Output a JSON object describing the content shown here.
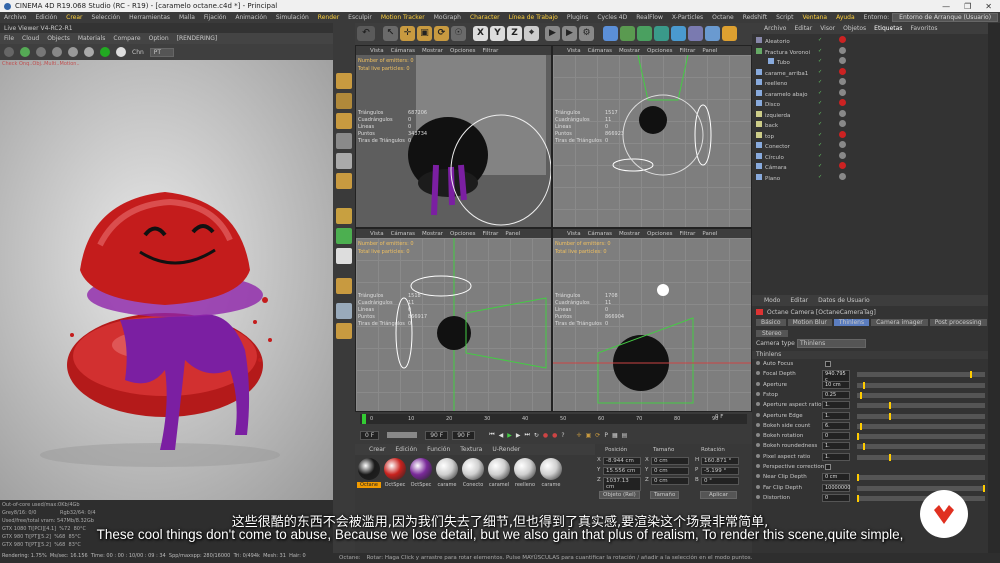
{
  "window": {
    "title": "CINEMA 4D R19.068 Studio (RC - R19) - [caramelo octane.c4d *] - Principal",
    "controls": [
      "—",
      "❐",
      "✕"
    ]
  },
  "menubar": {
    "items": [
      "Archivo",
      "Edición",
      "Crear",
      "Selección",
      "Herramientas",
      "Malla",
      "Fijación",
      "Animación",
      "Simulación",
      "Render",
      "Esculpir",
      "Motion Tracker",
      "MoGraph",
      "Character",
      "Línea de Trabajo",
      "Plugins",
      "Cycles 4D",
      "RealFlow",
      "X-Particles",
      "Octane",
      "Redshift",
      "Script",
      "Ventana",
      "Ayuda"
    ],
    "env_label": "Entorno:",
    "env_value": "Entorno de Arranque (Usuario)"
  },
  "live_viewer": {
    "title": "Live Viewer V4-RC2-R1",
    "menu": [
      "File",
      "Cloud",
      "Objects",
      "Materials",
      "Compare",
      "Option"
    ],
    "rendering_tag": "[RENDERING]",
    "channel_label": "Chn",
    "channel_value": "PT",
    "check_msg": "Check Onq..Obj..Multi..Motion..",
    "stats": [
      {
        "gpu": "GTX 1080 Ti[PCI][4.1]",
        "pct": "%72",
        "temp": "80°C"
      },
      {
        "gpu": "GTX 980 Ti[PT][5.2]",
        "pct": "%68",
        "temp": "85°C"
      },
      {
        "gpu": "GTX 980 Ti[PT][5.2]",
        "pct": "%68",
        "temp": "83°C"
      }
    ],
    "out_of_core": "Out-of-core used/max:0Kb/4Gb",
    "grey": "Grey8/16: 0/0",
    "rgb": "Rgb32/64: 0/4",
    "vram": "Used/free/total vram: 547Mb/8.32Gb",
    "rendering": "Rendering: 1.75%",
    "ms": "Ms/sec: 16.156",
    "time": "Time: 00 : 00 : 10/00 : 09 : 34",
    "spp": "Spp/maxspp: 280/16000",
    "tri": "Tri: 0/494k",
    "mesh": "Mesh: 31",
    "hair": "Hair: 0"
  },
  "viewport_menu": [
    "Vista",
    "Cámaras",
    "Mostrar",
    "Opciones",
    "Filtrar",
    "Panel"
  ],
  "viewports": [
    {
      "emitters": "Number of emitters: 0",
      "particles": "Total live particles: 0",
      "stats_labels": [
        "Triángulos",
        "Cuadrángulos",
        "Líneas",
        "Puntos",
        "Tiras de Triángulos"
      ],
      "stats_values": [
        "687206",
        "0",
        "0",
        "343734",
        "0"
      ]
    },
    {
      "emitters": "",
      "particles": "",
      "stats_labels": [
        "Triángulos",
        "Cuadrángulos",
        "Líneas",
        "Puntos",
        "Tiras de Triángulos"
      ],
      "stats_values": [
        "1517",
        "11",
        "0",
        "866923",
        "0"
      ]
    },
    {
      "emitters": "Number of emitters: 0",
      "particles": "Total live particles: 0",
      "stats_labels": [
        "Triángulos",
        "Cuadrángulos",
        "Líneas",
        "Puntos",
        "Tiras de Triángulos"
      ],
      "stats_values": [
        "1518",
        "11",
        "0",
        "866917",
        "0"
      ]
    },
    {
      "emitters": "Number of emitters: 0",
      "particles": "Total live particles: 0",
      "stats_labels": [
        "Triángulos",
        "Cuadrángulos",
        "Líneas",
        "Puntos",
        "Tiras de Triángulos"
      ],
      "stats_values": [
        "1708",
        "11",
        "0",
        "866904",
        "0"
      ]
    }
  ],
  "toolbar": {
    "axis_x": "X",
    "axis_y": "Y",
    "axis_z": "Z"
  },
  "timeline": {
    "ticks": [
      "0",
      "10",
      "20",
      "30",
      "40",
      "50",
      "60",
      "70",
      "80",
      "90"
    ],
    "end_label": "0 F",
    "start_field": "0 F",
    "current_field": "90 F",
    "end_field": "90 F"
  },
  "materials": {
    "menu": [
      "Crear",
      "Edición",
      "Función",
      "Textura",
      "U-Render"
    ],
    "items": [
      {
        "name": "Octane",
        "color": "#1a1a1a"
      },
      {
        "name": "OctSpec",
        "color": "#c8221e"
      },
      {
        "name": "OctSpec",
        "color": "#7a2a9a"
      },
      {
        "name": "carame",
        "color": "#cfcfcf"
      },
      {
        "name": "Conecto",
        "color": "#cfcfcf"
      },
      {
        "name": "caramel",
        "color": "#cfcfcf"
      },
      {
        "name": "reelleno",
        "color": "#cfcfcf"
      },
      {
        "name": "carame",
        "color": "#cfcfcf"
      }
    ]
  },
  "coords": {
    "headers": [
      "Posición",
      "Tamaño",
      "Rotación"
    ],
    "rows": [
      {
        "axis": "X",
        "pos": "-8.944 cm",
        "size_axis": "X",
        "size": "0 cm",
        "rot_axis": "H",
        "rot": "160.871 °"
      },
      {
        "axis": "Y",
        "pos": "15.556 cm",
        "size_axis": "Y",
        "size": "0 cm",
        "rot_axis": "P",
        "rot": "-5.199 °"
      },
      {
        "axis": "Z",
        "pos": "1037.13 cm",
        "size_axis": "Z",
        "size": "0 cm",
        "rot_axis": "B",
        "rot": "0 °"
      }
    ],
    "mode": "Objeto (Rel)",
    "size_mode": "Tamaño",
    "apply": "Aplicar"
  },
  "object_manager": {
    "menu": [
      "Archivo",
      "Editar",
      "Visor",
      "Objetos",
      "Etiquetas",
      "Favoritos"
    ],
    "objects": [
      {
        "name": "Aleatorio",
        "indent": 0
      },
      {
        "name": "Fractura Voronoi",
        "indent": 0
      },
      {
        "name": "Tubo",
        "indent": 1
      },
      {
        "name": "carame_arriba1",
        "indent": 0
      },
      {
        "name": "reelleno",
        "indent": 0
      },
      {
        "name": "caramelo abajo",
        "indent": 0
      },
      {
        "name": "Disco",
        "indent": 0
      },
      {
        "name": "izquierda",
        "indent": 0
      },
      {
        "name": "back",
        "indent": 0
      },
      {
        "name": "top",
        "indent": 0
      },
      {
        "name": "Conector",
        "indent": 0
      },
      {
        "name": "Círculo",
        "indent": 0
      },
      {
        "name": "Cámara",
        "indent": 0
      },
      {
        "name": "Plano",
        "indent": 0
      }
    ]
  },
  "attributes": {
    "menu": [
      "Modo",
      "Editar",
      "Datos de Usuario"
    ],
    "title": "Octane Camera [OctaneCameraTag]",
    "tabs": [
      "Básico",
      "Motion Blur",
      "Thinlens",
      "Camera imager",
      "Post processing"
    ],
    "tab2": "Stereo",
    "camera_type_label": "Camera type",
    "camera_type": "Thinlens",
    "section": "Thinlens",
    "params": [
      {
        "label": "Auto Focus",
        "value": "",
        "pos": 0
      },
      {
        "label": "Focal Depth",
        "value": "940.795 c",
        "pos": 0.9
      },
      {
        "label": "Aperture",
        "value": "10 cm",
        "pos": 0.05
      },
      {
        "label": "Fstop",
        "value": "0.25",
        "pos": 0.02
      },
      {
        "label": "Aperture aspect ratio",
        "value": "1.",
        "pos": 0.25
      },
      {
        "label": "Aperture Edge",
        "value": "1.",
        "pos": 0.25
      },
      {
        "label": "Bokeh side count",
        "value": "6.",
        "pos": 0.02
      },
      {
        "label": "Bokeh rotation",
        "value": "0",
        "pos": 0
      },
      {
        "label": "Bokeh roundedness",
        "value": "1.",
        "pos": 0.05
      },
      {
        "label": "Pixel aspect ratio",
        "value": "1.",
        "pos": 0.25
      },
      {
        "label": "Perspective correction",
        "value": "",
        "pos": 0
      },
      {
        "label": "Near Clip Depth",
        "value": "0 cm",
        "pos": 0
      },
      {
        "label": "Far Clip Depth",
        "value": "10000000",
        "pos": 1
      },
      {
        "label": "Distortion",
        "value": "0",
        "pos": 0
      }
    ]
  },
  "statusbar": {
    "label": "Octane:",
    "hint": "Rotar: Haga Click y arrastre para rotar elementos. Pulse MAYÚSCULAS para cuantificar la rotación / añadir a la selección en el modo puntos."
  },
  "subtitles": {
    "cn": "这些很酷的东西不会被滥用,因为我们失去了细节,但也得到了真实感,要渲染这个场景非常简单,",
    "en": "These cool things don't come to abuse, Because we lose detail, but we also gain that plus of realism, To render this scene,quite simple,"
  }
}
